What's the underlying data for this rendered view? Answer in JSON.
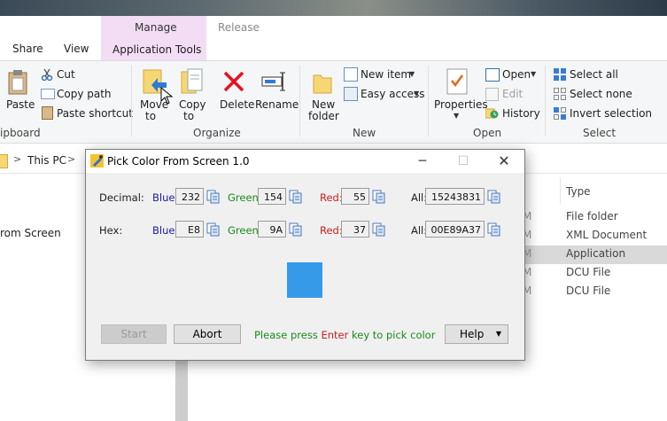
{
  "window": {
    "tabs": {
      "manage": "Manage",
      "release": "Release",
      "share": "Share",
      "view": "View",
      "application_tools": "Application Tools"
    }
  },
  "ribbon": {
    "clipboard": {
      "paste": "Paste",
      "cut": "Cut",
      "copy_path": "Copy path",
      "paste_shortcut": "Paste shortcut",
      "group": "ipboard"
    },
    "organize": {
      "move_to": "Move",
      "move_to_2": "to",
      "copy_to": "Copy",
      "copy_to_2": "to",
      "delete": "Delete",
      "rename": "Rename",
      "group": "Organize"
    },
    "new": {
      "new_folder": "New",
      "new_folder_2": "folder",
      "new_item": "New item",
      "easy_access": "Easy access",
      "group": "New"
    },
    "open": {
      "properties": "Properties",
      "open": "Open",
      "edit": "Edit",
      "history": "History",
      "group": "Open"
    },
    "select": {
      "select_all": "Select all",
      "select_none": "Select none",
      "invert_selection": "Invert selection",
      "group": "Select"
    }
  },
  "address": {
    "crumb": "This PC",
    "crumb_sep": ">"
  },
  "file_list": {
    "type_header": "Type",
    "left_fragment": "rom Screen",
    "rows": [
      {
        "date_frag": "M",
        "type": "File folder"
      },
      {
        "date_frag": "M",
        "type": "XML Document"
      },
      {
        "date_frag": "M",
        "type": "Application"
      },
      {
        "date_frag": "M",
        "type": "DCU File"
      },
      {
        "date_frag": "M",
        "type": "DCU File"
      }
    ]
  },
  "dialog": {
    "title": "Pick Color From Screen 1.0",
    "decimal": {
      "label": "Decimal:",
      "blue_label": "Blue:",
      "blue": "232",
      "green_label": "Green:",
      "green": "154",
      "red_label": "Red:",
      "red": "55",
      "all_label": "All:",
      "all": "15243831"
    },
    "hex": {
      "label": "Hex:",
      "blue_label": "Blue:",
      "blue": "E8",
      "green_label": "Green:",
      "green": "9A",
      "red_label": "Red:",
      "red": "37",
      "all_label": "All:",
      "all": "00E89A37"
    },
    "swatch_color": "#379AE8",
    "buttons": {
      "start": "Start",
      "abort": "Abort",
      "help": "Help"
    },
    "hint": {
      "prefix": "Please press ",
      "key": "Enter",
      "suffix": " key to pick color"
    }
  },
  "colors": {
    "blue_label": "#1a1aa6",
    "green_label": "#1a8a1a",
    "red_label": "#c81e1e",
    "manage_tab": "#f2ddf5",
    "delete_red": "#e81123"
  }
}
